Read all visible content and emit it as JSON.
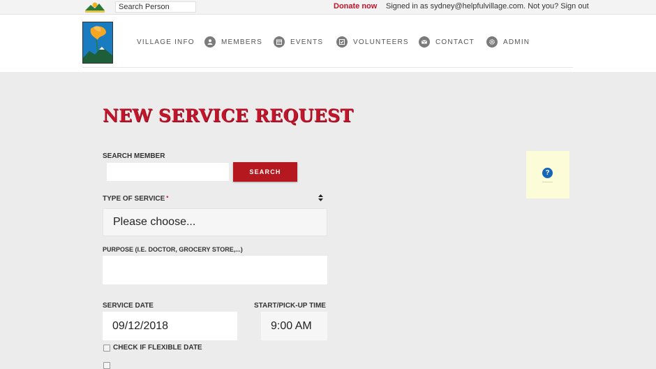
{
  "topbar": {
    "search_placeholder": "Search Person",
    "donate_label": "Donate now",
    "signed_in_text": "Signed in as sydney@helpfulvillage.com.",
    "not_you_text": "Not you?",
    "sign_out_label": "Sign out"
  },
  "nav": {
    "items": [
      {
        "label": "VILLAGE INFO",
        "icon": "none"
      },
      {
        "label": "MEMBERS",
        "icon": "person-icon"
      },
      {
        "label": "EVENTS",
        "icon": "calendar-icon"
      },
      {
        "label": "VOLUNTEERS",
        "icon": "checkbox-icon"
      },
      {
        "label": "CONTACT",
        "icon": "mail-icon"
      },
      {
        "label": "ADMIN",
        "icon": "gear-icon"
      }
    ]
  },
  "form": {
    "title": "NEW SERVICE REQUEST",
    "search_member_label": "SEARCH MEMBER",
    "search_member_value": "",
    "search_button_label": "SEARCH",
    "type_of_service_label": "TYPE OF SERVICE",
    "required_marker": "*",
    "type_of_service_value": "Please choose...",
    "purpose_label": "PURPOSE (I.E. DOCTOR, GROCERY STORE,...)",
    "purpose_value": "",
    "service_date_label": "SERVICE DATE",
    "service_date_value": "09/12/2018",
    "start_time_label": "START/PICK-UP TIME",
    "start_time_value": "9:00 AM",
    "flexible_date_label": "CHECK IF FLEXIBLE DATE"
  },
  "help": {
    "icon_text": "?"
  },
  "colors": {
    "brand_red": "#c0152a",
    "button_red": "#b5181f",
    "help_bg": "#fdfcd8",
    "help_blue": "#1565b8",
    "page_bg": "#ececec"
  }
}
